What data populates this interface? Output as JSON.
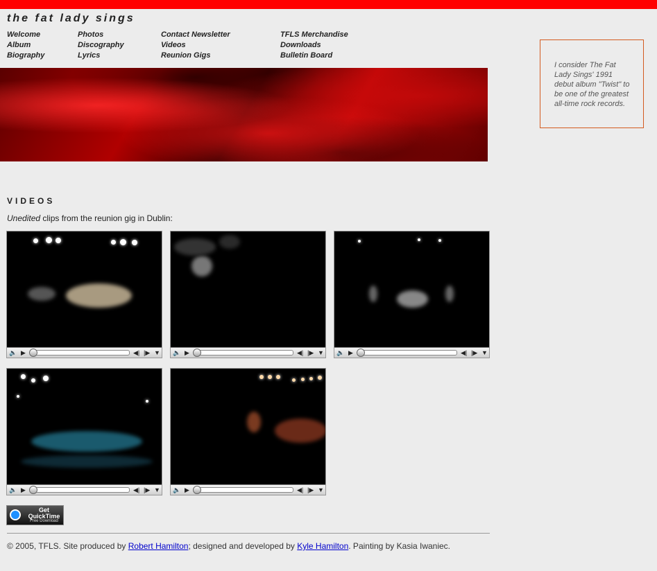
{
  "site": {
    "title": "the fat lady sings"
  },
  "nav": {
    "columns": [
      [
        "Welcome",
        "Album",
        "Biography"
      ],
      [
        "Photos",
        "Discography",
        "Lyrics"
      ],
      [
        "Contact Newsletter",
        "Videos",
        "Reunion Gigs"
      ],
      [
        "TFLS Merchandise",
        "Downloads",
        "Bulletin Board"
      ]
    ]
  },
  "quote": {
    "text": "I consider The Fat Lady Sings' 1991 debut album \"Twist\" to be one of the greatest all-time rock records."
  },
  "videos": {
    "heading": "VIDEOS",
    "intro_em": "Unedited",
    "intro_rest": " clips from the reunion gig in Dublin:"
  },
  "quicktime": {
    "line1": "Get",
    "line2": "QuickTime",
    "line3": "Free Download"
  },
  "footer": {
    "prefix": "© 2005, TFLS. Site produced by ",
    "link1": "Robert Hamilton",
    "middle": "; designed and developed by ",
    "link2": "Kyle Hamilton",
    "suffix": ". Painting by Kasia Iwaniec."
  },
  "colors": {
    "top_bar": "#ff0000",
    "quote_border": "#d45a1e",
    "link": "#0000cc"
  }
}
